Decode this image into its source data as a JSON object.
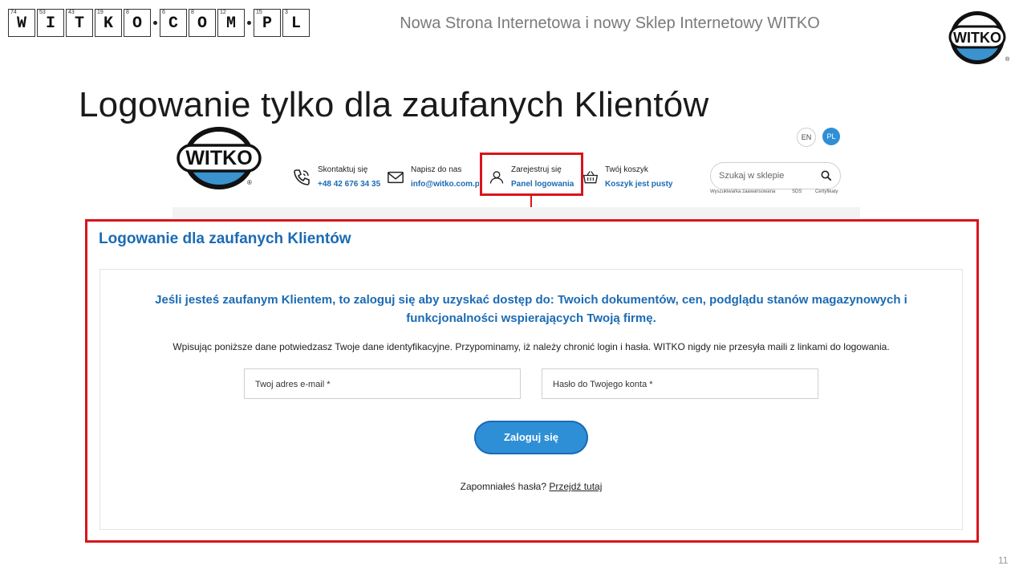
{
  "brand_logo": {
    "cells": [
      {
        "num": "74",
        "sym": "W"
      },
      {
        "num": "53",
        "sym": "I"
      },
      {
        "num": "43",
        "sym": "T"
      },
      {
        "num": "19",
        "sym": "K"
      },
      {
        "num": "8",
        "sym": "O"
      },
      {
        "num": "6",
        "sym": "C"
      },
      {
        "num": "8",
        "sym": "O"
      },
      {
        "num": "12",
        "sym": "M"
      },
      {
        "num": "15",
        "sym": "P"
      },
      {
        "num": "3",
        "sym": "L"
      }
    ],
    "text": "WITKO.COM.PL"
  },
  "slide": {
    "header": "Nowa Strona Internetowa i nowy Sklep Internetowy WITKO",
    "title": "Logowanie tylko dla zaufanych Klientów",
    "page_number": "11",
    "corner_logo": "WITKO"
  },
  "site": {
    "logo_text": "WITKO",
    "languages": [
      "EN",
      "PL"
    ],
    "active_language": "PL",
    "contact": {
      "label": "Skontaktuj się",
      "value": "+48 42 676 34 35",
      "icon": "phone-icon"
    },
    "email": {
      "label": "Napisz do nas",
      "value": "info@witko.com.pl",
      "icon": "envelope-icon"
    },
    "account": {
      "label": "Zarejestruj się",
      "value": "Panel logowania",
      "icon": "user-icon"
    },
    "cart": {
      "label": "Twój koszyk",
      "value": "Koszyk jest pusty",
      "icon": "basket-icon"
    },
    "search": {
      "placeholder": "Szukaj w sklepie",
      "icon": "search-icon"
    },
    "sub_links": [
      "Wyszukiwarka zaawansowana",
      "SDS",
      "Certyfikaty"
    ]
  },
  "login": {
    "section_title": "Logowanie dla zaufanych Klientów",
    "intro": "Jeśli jesteś zaufanym Klientem, to zaloguj się aby uzyskać dostęp do: Twoich dokumentów, cen, podglądu stanów magazynowych i funkcjonalności wspierających Twoją firmę.",
    "info": "Wpisując poniższe dane potwiedzasz Twoje dane identyfikacyjne. Przypominamy, iż należy chronić login i hasła. WITKO nigdy nie przesyła maili z linkami do logowania.",
    "email_placeholder": "Twoj adres e-mail *",
    "password_placeholder": "Hasło do Twojego konta *",
    "submit_label": "Zaloguj się",
    "forgot_text": "Zapomniałeś hasła?",
    "forgot_link": "Przejdź tutaj"
  },
  "colors": {
    "brand_blue": "#1b6bb4",
    "button_blue": "#2f8fd6",
    "highlight_red": "#d9141c"
  }
}
